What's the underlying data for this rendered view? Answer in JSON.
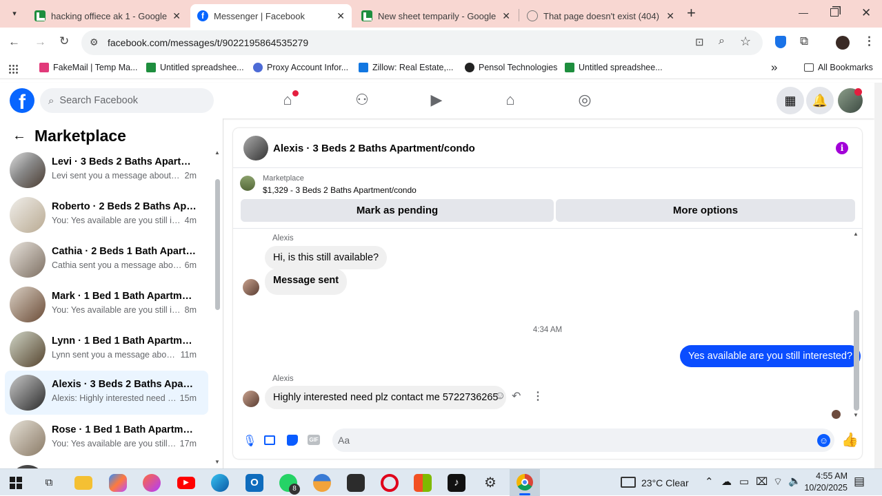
{
  "browser": {
    "tabs": [
      {
        "title": "hacking offiece ak 1 - Google Sh",
        "icon": "sheets-icon"
      },
      {
        "title": "Messenger | Facebook",
        "icon": "facebook-icon"
      },
      {
        "title": "New sheet temparily - Google Sh",
        "icon": "sheets-icon"
      },
      {
        "title": "That page doesn't exist (404) - F",
        "icon": "globe-icon"
      }
    ],
    "new_tab": "+",
    "url": "facebook.com/messages/t/9022195864535279",
    "bookmarks": [
      "FakeMail | Temp Ma...",
      "Untitled spreadshee...",
      "Proxy Account Infor...",
      "Zillow: Real Estate,...",
      "Pensol Technologies",
      "Untitled spreadshee..."
    ],
    "more_bookmarks": "»",
    "all_bookmarks": "All Bookmarks"
  },
  "facebook": {
    "logo": "f",
    "search_placeholder": "Search Facebook"
  },
  "left_panel": {
    "title": "Marketplace",
    "conversations": [
      {
        "name": "Levi · 3 Beds 2 Baths Apartment...",
        "snippet": "Levi sent you a message about yo...",
        "time": "2m",
        "selected": false
      },
      {
        "name": "Roberto · 2 Beds 2 Baths Apart...",
        "snippet": "You: Yes available are you still inter...",
        "time": "4m",
        "selected": false
      },
      {
        "name": "Cathia · 2 Beds 1 Bath Apartmen...",
        "snippet": "Cathia sent you a message about ...",
        "time": "6m",
        "selected": false
      },
      {
        "name": "Mark · 1 Bed 1 Bath Apartment/...",
        "snippet": "You: Yes available are you still inter...",
        "time": "8m",
        "selected": false
      },
      {
        "name": "Lynn · 1 Bed 1 Bath Apartment/c...",
        "snippet": "Lynn sent you a message about y...",
        "time": "11m",
        "selected": false
      },
      {
        "name": "Alexis · 3 Beds 2 Baths Apartme...",
        "snippet": "Alexis: Highly interested need plz...",
        "time": "15m",
        "selected": true
      },
      {
        "name": "Rose · 1 Bed 1 Bath Apartment/c...",
        "snippet": "You: Yes available are you still int...",
        "time": "17m",
        "selected": false
      }
    ]
  },
  "chat": {
    "title": "Alexis · 3 Beds 2 Baths Apartment/condo",
    "marketplace_label": "Marketplace",
    "listing": "$1,329 - 3 Beds 2 Baths Apartment/condo",
    "mark_pending": "Mark as pending",
    "more_options": "More options",
    "messages": [
      {
        "sender": "Alexis",
        "text": "Hi, is this still available?"
      },
      {
        "text": "Message sent"
      },
      {
        "timestamp": "4:34 AM"
      },
      {
        "text": "Yes available are you still  interested?",
        "mine": true
      },
      {
        "sender": "Alexis",
        "text": "Highly interested need plz contact me 5722736265"
      }
    ],
    "input_placeholder": "Aa"
  },
  "taskbar": {
    "whatsapp_badge": "8",
    "weather": "23°C  Clear",
    "time": "4:55 AM",
    "date": "10/20/2025"
  },
  "colors": {
    "tab_strip": "#f8d7d2",
    "facebook_blue": "#0866ff",
    "my_bubble": "#0a4dff",
    "selected_conversation": "#ebf5ff",
    "info_icon": "#a200d8"
  }
}
